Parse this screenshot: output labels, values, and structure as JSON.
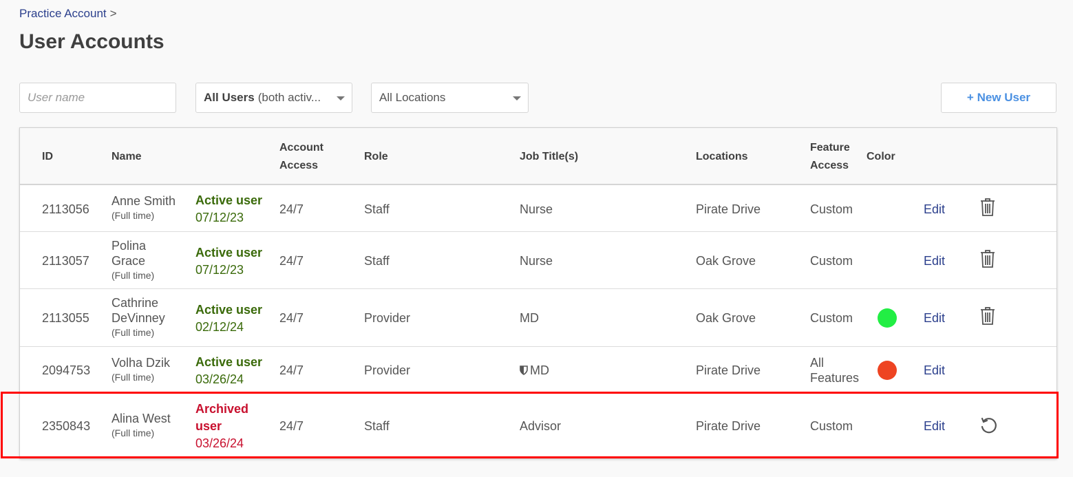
{
  "breadcrumb": {
    "parent": "Practice Account",
    "separator": ">"
  },
  "page_title": "User Accounts",
  "filters": {
    "user_name_placeholder": "User name",
    "users_select_bold": "All Users",
    "users_select_rest": "(both activ...",
    "locations_select": "All Locations"
  },
  "new_user_button": "+ New User",
  "table": {
    "headers": {
      "id": "ID",
      "name": "Name",
      "account_access": "Account Access",
      "role": "Role",
      "job_titles": "Job Title(s)",
      "locations": "Locations",
      "feature_access": "Feature Access",
      "color": "Color"
    },
    "rows": [
      {
        "id": "2113056",
        "name": "Anne Smith",
        "type": "(Full time)",
        "status": "Active user",
        "date": "07/12/23",
        "access": "24/7",
        "role": "Staff",
        "job_title": "Nurse",
        "location": "Pirate Drive",
        "feature": "Custom",
        "edit": "Edit"
      },
      {
        "id": "2113057",
        "name": "Polina Grace",
        "type": "(Full time)",
        "status": "Active user",
        "date": "07/12/23",
        "access": "24/7",
        "role": "Staff",
        "job_title": "Nurse",
        "location": "Oak Grove",
        "feature": "Custom",
        "edit": "Edit"
      },
      {
        "id": "2113055",
        "name": "Cathrine DeVinney",
        "type": "(Full time)",
        "status": "Active user",
        "date": "02/12/24",
        "access": "24/7",
        "role": "Provider",
        "job_title": "MD",
        "location": "Oak Grove",
        "feature": "Custom",
        "color": "#22ee44",
        "edit": "Edit"
      },
      {
        "id": "2094753",
        "name": "Volha Dzik",
        "type": "(Full time)",
        "status": "Active user",
        "date": "03/26/24",
        "access": "24/7",
        "role": "Provider",
        "job_title": "MD",
        "location": "Pirate Drive",
        "feature": "All Features",
        "color": "#ee4422",
        "edit": "Edit"
      },
      {
        "id": "2350843",
        "name": "Alina West",
        "type": "(Full time)",
        "status": "Archived user",
        "date": "03/26/24",
        "access": "24/7",
        "role": "Staff",
        "job_title": "Advisor",
        "location": "Pirate Drive",
        "feature": "Custom",
        "edit": "Edit"
      }
    ]
  },
  "colors": {
    "active": "#3a6a0a",
    "archived": "#c8102e",
    "link": "#2b3f8c",
    "accent": "#4a90e2",
    "highlight": "#ff0000"
  },
  "icons": {
    "delete": "trash-icon",
    "restore": "restore-icon",
    "badge": "shield-icon"
  }
}
